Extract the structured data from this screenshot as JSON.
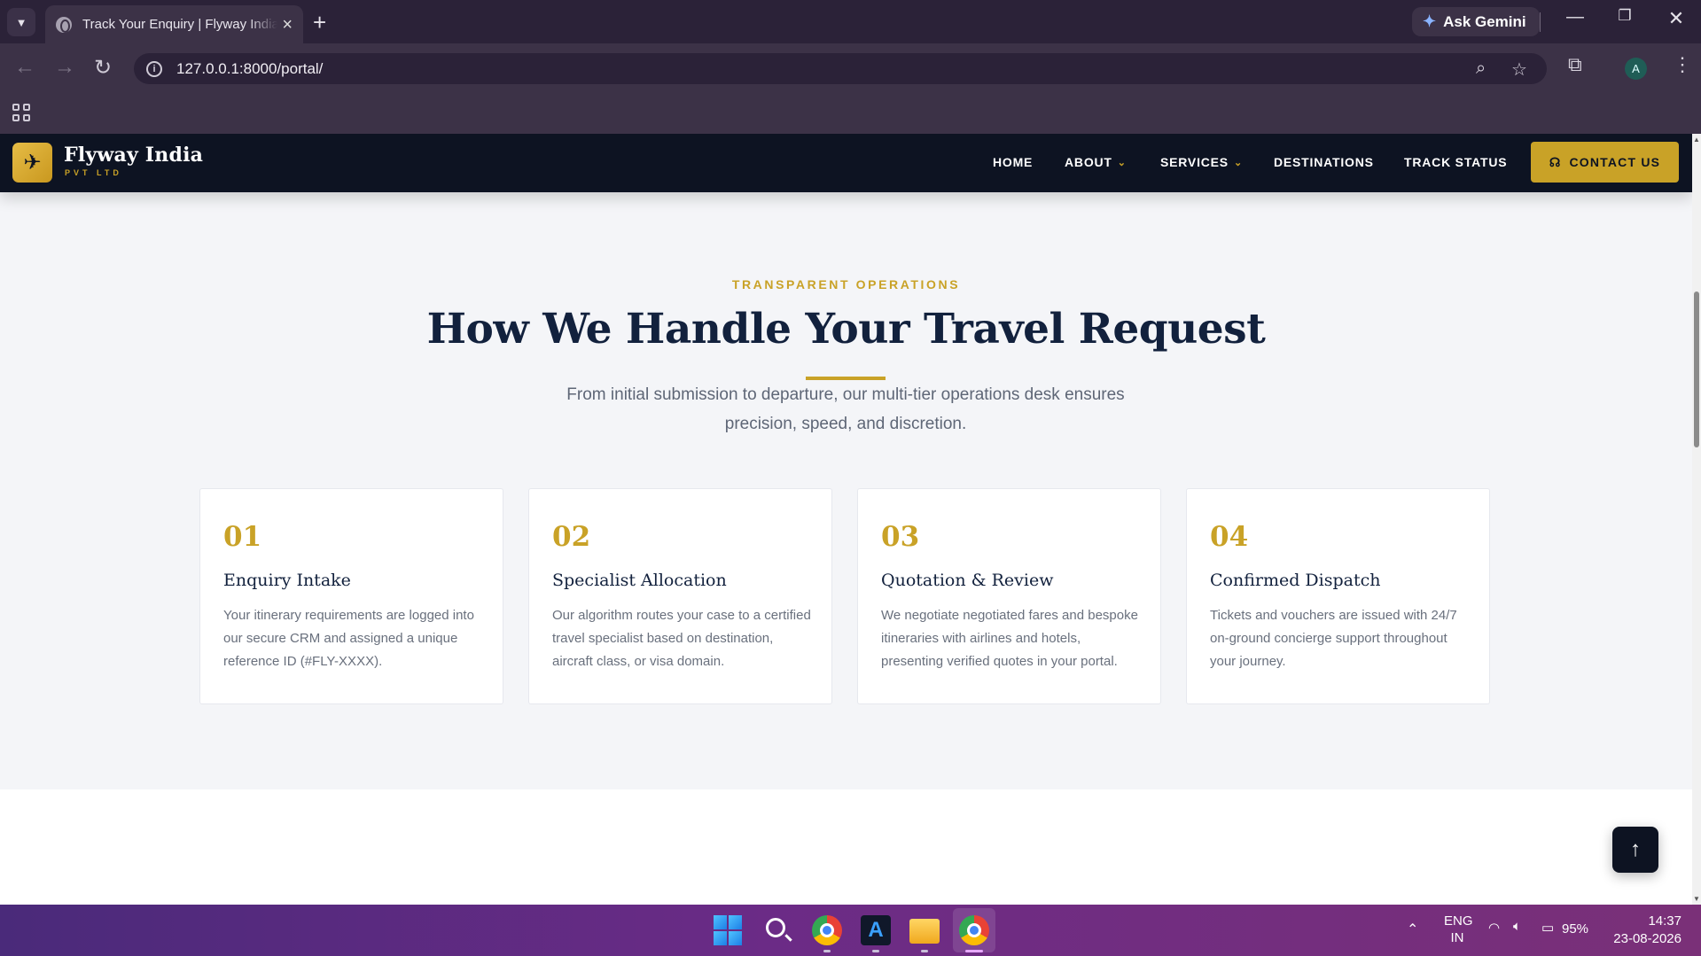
{
  "browser": {
    "tab_title": "Track Your Enquiry | Flyway India Pvt Ltd",
    "url": "127.0.0.1:8000/portal/",
    "gemini_label": "Ask Gemini",
    "profile_initial": "A"
  },
  "header": {
    "brand_name": "Flyway India",
    "brand_sub": "PVT LTD",
    "nav": {
      "home": "HOME",
      "about": "ABOUT",
      "services": "SERVICES",
      "destinations": "DESTINATIONS",
      "track": "TRACK STATUS"
    },
    "contact_label": "CONTACT US"
  },
  "section": {
    "eyebrow": "TRANSPARENT OPERATIONS",
    "title": "How We Handle Your Travel Request",
    "lead": "From initial submission to departure, our multi-tier operations desk ensures precision, speed, and discretion.",
    "steps": [
      {
        "num": "01",
        "title": "Enquiry Intake",
        "desc": "Your itinerary requirements are logged into our secure CRM and assigned a unique reference ID (#FLY-XXXX)."
      },
      {
        "num": "02",
        "title": "Specialist Allocation",
        "desc": "Our algorithm routes your case to a certified travel specialist based on destination, aircraft class, or visa domain."
      },
      {
        "num": "03",
        "title": "Quotation & Review",
        "desc": "We negotiate negotiated fares and bespoke itineraries with airlines and hotels, presenting verified quotes in your portal."
      },
      {
        "num": "04",
        "title": "Confirmed Dispatch",
        "desc": "Tickets and vouchers are issued with 24/7 on-ground concierge support throughout your journey."
      }
    ]
  },
  "taskbar": {
    "lang_top": "ENG",
    "lang_bottom": "IN",
    "battery": "95%",
    "time": "14:37",
    "date": "23-08-2026"
  },
  "colors": {
    "gold": "#c9a227",
    "navy": "#0d1322",
    "heading": "#12213d"
  }
}
